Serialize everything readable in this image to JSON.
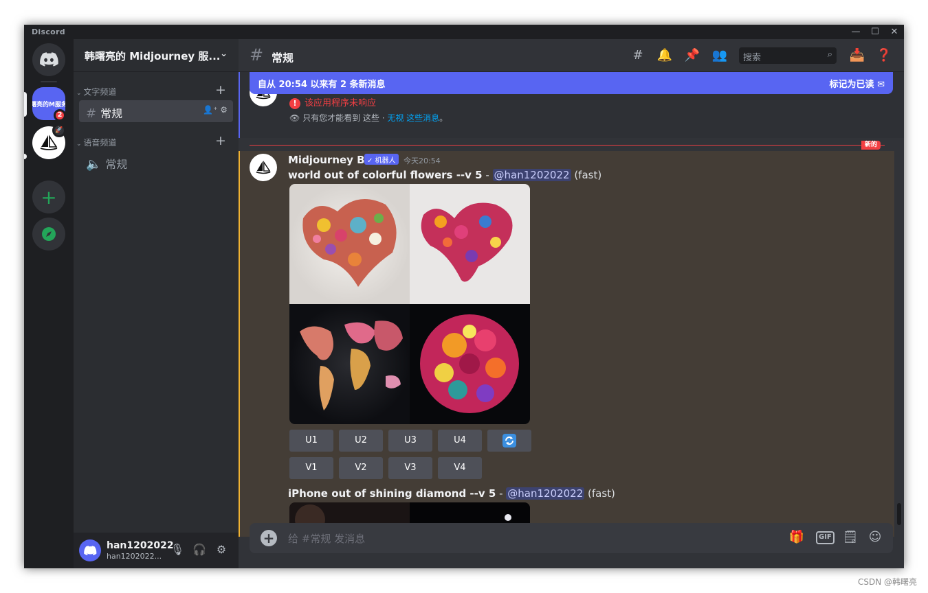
{
  "app": {
    "title": "Discord"
  },
  "rail": {
    "server1_label": "曙亮的M服务",
    "server1_badge": "2"
  },
  "guild": {
    "name": "韩曙亮的 Midjourney 服..."
  },
  "categories": {
    "text": "文字频道",
    "voice": "语音频道"
  },
  "channels": {
    "text_channel": "常规",
    "voice_channel": "常规"
  },
  "user": {
    "name": "han1202022",
    "tag": "han1202022..."
  },
  "header": {
    "channel": "常规",
    "search_placeholder": "搜索"
  },
  "new_messages": {
    "text": "自从 20:54 以来有 2 条新消息",
    "mark_read": "标记为已读"
  },
  "ephemeral": {
    "error": "该应用程序未响应",
    "only_you": "只有您才能看到 这些 · ",
    "dismiss": "无视 这些消息",
    "period": "。"
  },
  "divider": {
    "label": "新的"
  },
  "message": {
    "author": "Midjourney Bot",
    "badge": "✓ 机器人",
    "time": "今天20:54",
    "prompt1": "world out of colorful flowers --v 5",
    "prompt2": "iPhone out of shining diamond --v 5",
    "separator": " - ",
    "mention": "@han1202022",
    "speed": " (fast)",
    "upscale_buttons": [
      "U1",
      "U2",
      "U3",
      "U4"
    ],
    "variation_buttons": [
      "V1",
      "V2",
      "V3",
      "V4"
    ]
  },
  "composer": {
    "placeholder": "给 #常规 发消息",
    "gif": "GIF"
  },
  "watermark": "CSDN @韩曙亮"
}
